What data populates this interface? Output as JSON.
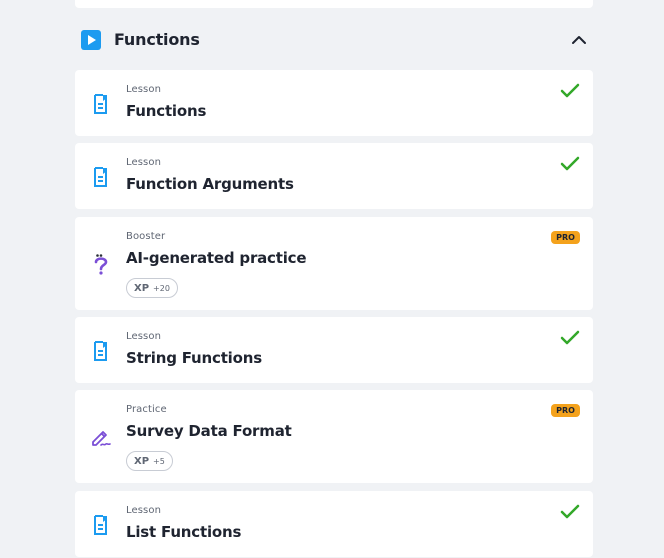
{
  "section": {
    "title": "Functions",
    "icon": "play-icon",
    "accent": "#1c9bf0",
    "toggle_icon": "chevron-up-icon"
  },
  "items": [
    {
      "kind": "Lesson",
      "title": "Functions",
      "icon": "lesson-document-icon",
      "status": "completed"
    },
    {
      "kind": "Lesson",
      "title": "Function Arguments",
      "icon": "lesson-document-icon",
      "status": "completed"
    },
    {
      "kind": "Booster",
      "title": "AI-generated practice",
      "icon": "question-mark-icon",
      "badge": "PRO",
      "xp_label": "XP",
      "xp_value": "+20"
    },
    {
      "kind": "Lesson",
      "title": "String Functions",
      "icon": "lesson-document-icon",
      "status": "completed"
    },
    {
      "kind": "Practice",
      "title": "Survey Data Format",
      "icon": "pencil-icon",
      "badge": "PRO",
      "xp_label": "XP",
      "xp_value": "+5"
    },
    {
      "kind": "Lesson",
      "title": "List Functions",
      "icon": "lesson-document-icon",
      "status": "completed"
    }
  ],
  "colors": {
    "lesson_icon": "#1c9bf0",
    "booster_icon": "#7b4fd6",
    "check": "#33a829",
    "pro_badge": "#f4a21c",
    "background": "#f0f2f5"
  }
}
